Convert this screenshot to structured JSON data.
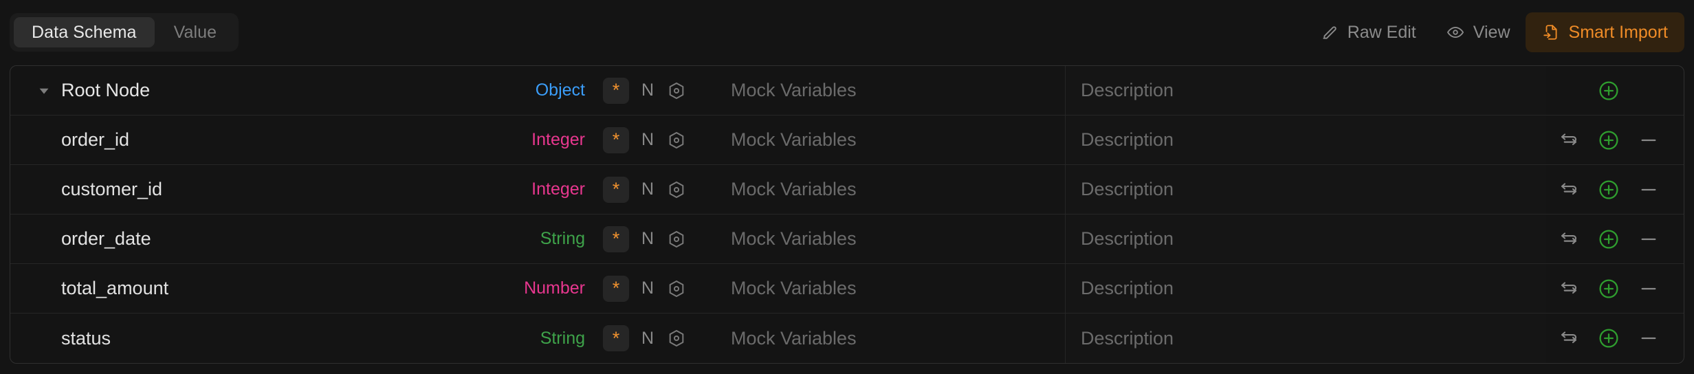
{
  "toolbar": {
    "tabs": [
      {
        "label": "Data Schema",
        "active": true
      },
      {
        "label": "Value",
        "active": false
      }
    ],
    "actions": [
      {
        "label": "Raw Edit",
        "icon": "pencil-icon",
        "primary": false
      },
      {
        "label": "View",
        "icon": "eye-icon",
        "primary": false
      },
      {
        "label": "Smart Import",
        "icon": "file-import-icon",
        "primary": true
      }
    ]
  },
  "colors": {
    "accent_orange": "#f08c27",
    "type_object": "#3b9df8",
    "type_integer": "#e8378f",
    "type_number": "#e8378f",
    "type_string": "#3ea34a",
    "add_green": "#2f9e2f",
    "background": "#141414",
    "row_border": "#262626"
  },
  "table": {
    "required_marker": "*",
    "nullable_flag": "N",
    "mock_placeholder": "Mock Variables",
    "description_placeholder": "Description",
    "rows": [
      {
        "name": "Root Node",
        "type": "Object",
        "type_color": "#3b9df8",
        "required": "*",
        "nullable": "N",
        "is_root": true,
        "has_caret": true,
        "mock": "Mock Variables",
        "description": "Description",
        "actions": {
          "swap": false,
          "add": true,
          "remove": false
        }
      },
      {
        "name": "order_id",
        "type": "Integer",
        "type_color": "#e8378f",
        "required": "*",
        "nullable": "N",
        "is_root": false,
        "has_caret": false,
        "mock": "Mock Variables",
        "description": "Description",
        "actions": {
          "swap": true,
          "add": true,
          "remove": true
        }
      },
      {
        "name": "customer_id",
        "type": "Integer",
        "type_color": "#e8378f",
        "required": "*",
        "nullable": "N",
        "is_root": false,
        "has_caret": false,
        "mock": "Mock Variables",
        "description": "Description",
        "actions": {
          "swap": true,
          "add": true,
          "remove": true
        }
      },
      {
        "name": "order_date",
        "type": "String",
        "type_color": "#3ea34a",
        "required": "*",
        "nullable": "N",
        "is_root": false,
        "has_caret": false,
        "mock": "Mock Variables",
        "description": "Description",
        "actions": {
          "swap": true,
          "add": true,
          "remove": true
        }
      },
      {
        "name": "total_amount",
        "type": "Number",
        "type_color": "#e8378f",
        "required": "*",
        "nullable": "N",
        "is_root": false,
        "has_caret": false,
        "mock": "Mock Variables",
        "description": "Description",
        "actions": {
          "swap": true,
          "add": true,
          "remove": true
        }
      },
      {
        "name": "status",
        "type": "String",
        "type_color": "#3ea34a",
        "required": "*",
        "nullable": "N",
        "is_root": false,
        "has_caret": false,
        "mock": "Mock Variables",
        "description": "Description",
        "actions": {
          "swap": true,
          "add": true,
          "remove": true
        }
      }
    ]
  }
}
